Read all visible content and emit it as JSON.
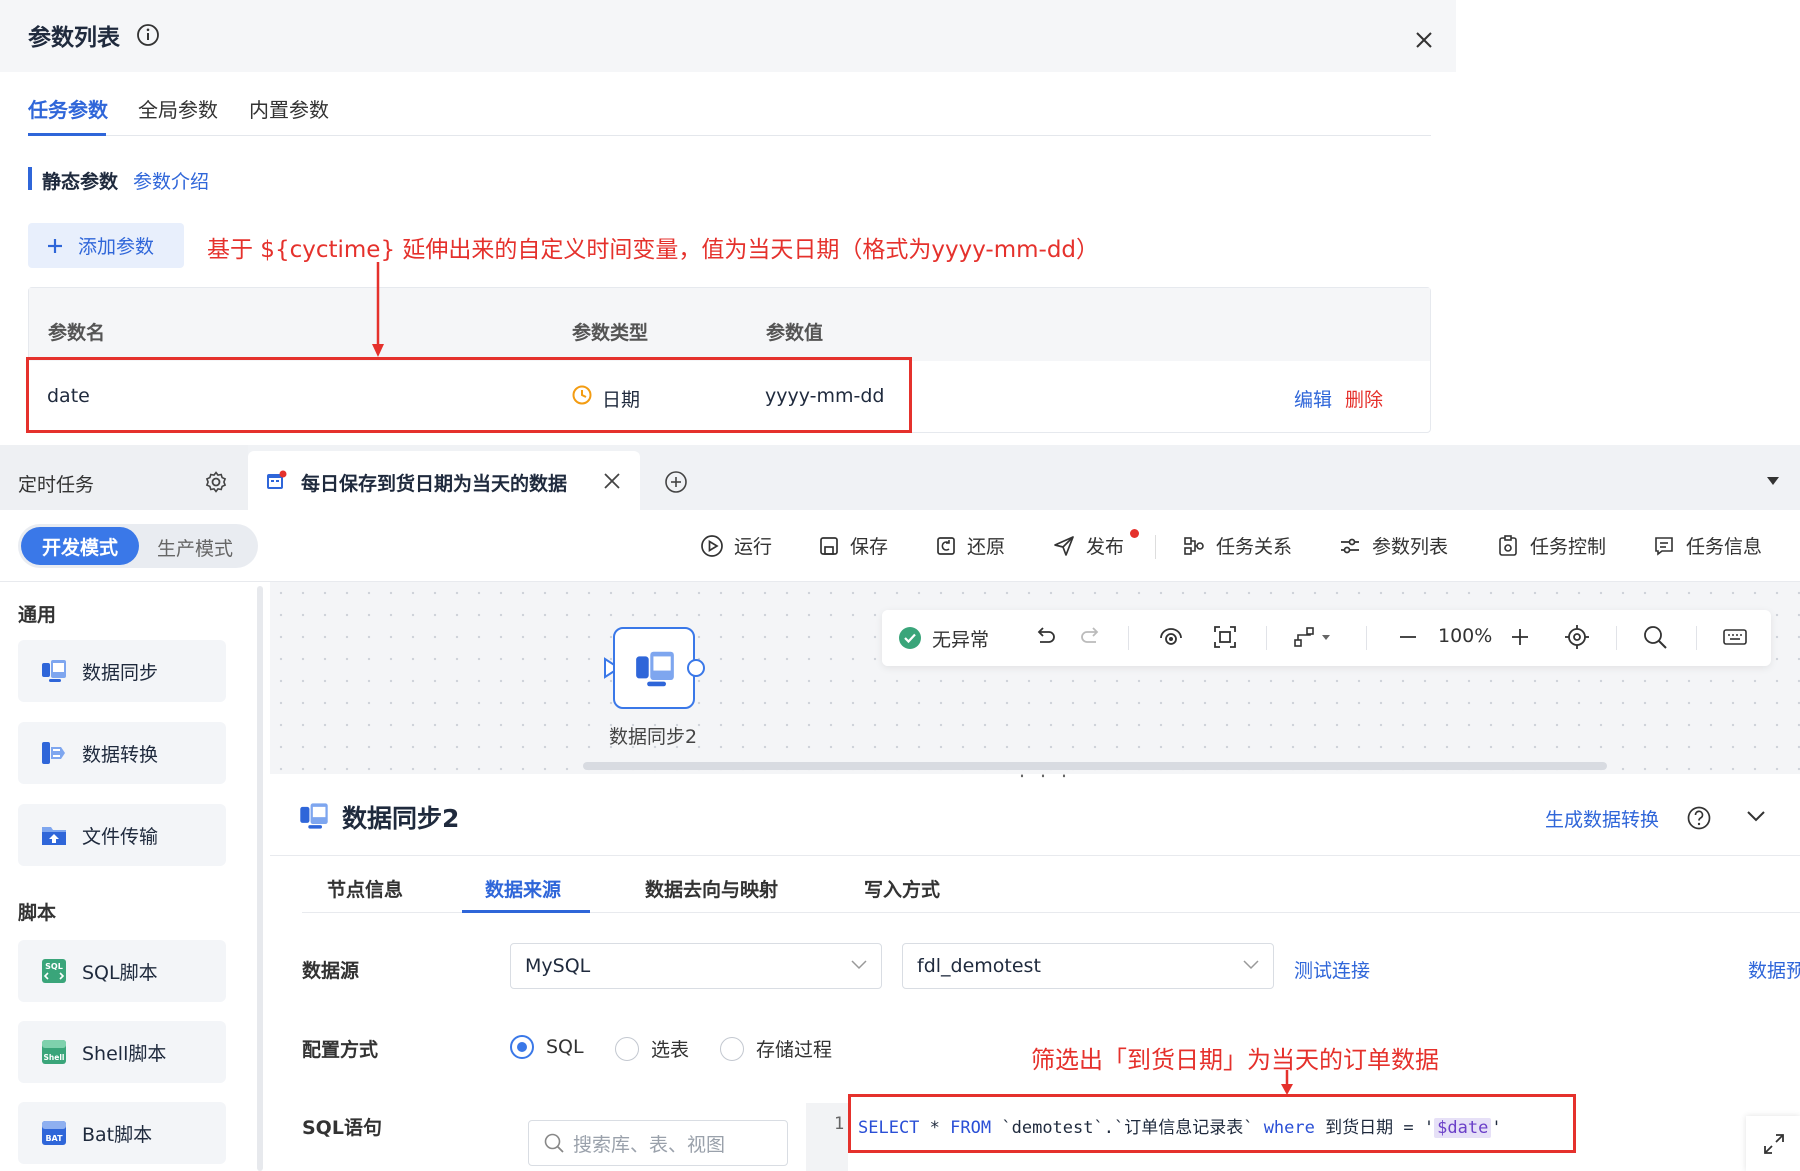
{
  "param_panel": {
    "title": "参数列表",
    "tabs": [
      "任务参数",
      "全局参数",
      "内置参数"
    ],
    "section_title": "静态参数",
    "section_link": "参数介绍",
    "add_button": "添加参数",
    "annotation": "基于 ${cyctime} 延伸出来的自定义时间变量，值为当天日期（格式为yyyy-mm-dd）",
    "table": {
      "columns": [
        "参数名",
        "参数类型",
        "参数值"
      ],
      "rows": [
        {
          "name": "date",
          "type": "日期",
          "value": "yyyy-mm-dd",
          "edit": "编辑",
          "delete": "删除"
        }
      ]
    }
  },
  "tabbar": {
    "scheduled": "定时任务",
    "active_tab": "每日保存到货日期为当天的数据"
  },
  "toolbar": {
    "mode_dev": "开发模式",
    "mode_prod": "生产模式",
    "run": "运行",
    "save": "保存",
    "restore": "还原",
    "publish": "发布",
    "task_relation": "任务关系",
    "param_list": "参数列表",
    "task_control": "任务控制",
    "task_info": "任务信息"
  },
  "sidebar": {
    "group_general": "通用",
    "general_items": [
      "数据同步",
      "数据转换",
      "文件传输"
    ],
    "group_script": "脚本",
    "script_items": [
      "SQL脚本",
      "Shell脚本",
      "Bat脚本"
    ]
  },
  "canvas": {
    "status": "无异常",
    "zoom": "100%",
    "node_label": "数据同步2"
  },
  "config": {
    "title": "数据同步2",
    "gen_link": "生成数据转换",
    "tabs": [
      "节点信息",
      "数据来源",
      "数据去向与映射",
      "写入方式"
    ],
    "datasource_label": "数据源",
    "datasource_type": "MySQL",
    "datasource_db": "fdl_demotest",
    "test_conn": "测试连接",
    "preview_link": "数据预",
    "config_mode_label": "配置方式",
    "modes": [
      "SQL",
      "选表",
      "存储过程"
    ],
    "sql_label": "SQL语句",
    "search_placeholder": "搜索库、表、视图",
    "annotation": "筛选出「到货日期」为当天的订单数据",
    "sql": {
      "line_no": "1",
      "kw_select": "SELECT",
      "star": "*",
      "kw_from": "FROM",
      "table": "`demotest`.`订单信息记录表`",
      "kw_where": "where",
      "field": "到货日期",
      "eq": "=",
      "quote_open": "'",
      "var": "$date",
      "quote_close": "'"
    }
  },
  "colors": {
    "accent": "#2f66d9",
    "annotation_red": "#e5312c",
    "dev_mode": "#3a78e8"
  }
}
